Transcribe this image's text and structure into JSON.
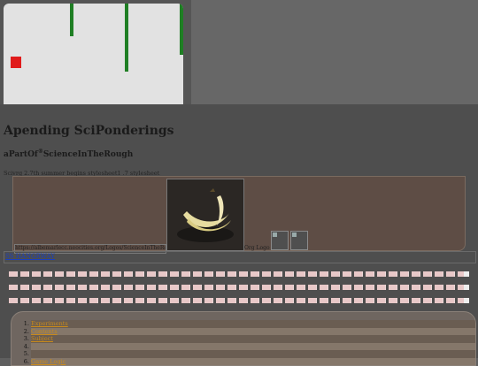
{
  "site": {
    "title": "Apending SciPonderings",
    "subtitle_prefix": "aPartOf",
    "subtitle_sup": "®",
    "subtitle_rest": "ScienceInTheRough",
    "meta_line": "Scivrg 2.7th summer begins stylesheet1 .7 stylesheet"
  },
  "banner": {
    "image_url": "https://albemarlecc.neocities.org/Logos/ScienceInTheRough",
    "org_logo_label": "Org Logo"
  },
  "hangar_link": "SS HANGRWAY",
  "nav": {
    "items": [
      "Experiments",
      "Contents",
      "Subject",
      "",
      "",
      "Game Logic"
    ]
  },
  "colors": {
    "game_bg": "#e2e2e2",
    "pipe": "#1f7f24",
    "player": "#e01b1b",
    "banner": "#5e4d45",
    "link_orange": "#c98a1a",
    "link_blue": "#1a3fbf"
  },
  "icons": [
    "player-square-icon",
    "pipe-obstacle-icon",
    "banana-photo",
    "broken-image-icon"
  ]
}
